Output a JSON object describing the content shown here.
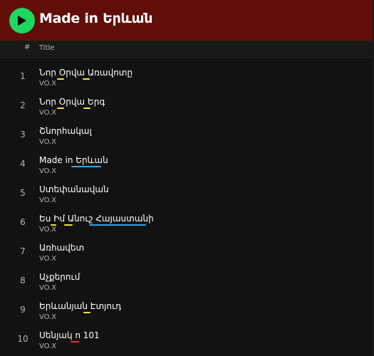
{
  "album": {
    "title": "Made in Երևան"
  },
  "header": {
    "index_label": "#",
    "title_label": "Title"
  },
  "tracks": [
    {
      "number": "1",
      "title": "Նոր Օրվա Առավոտը",
      "artist": "VO.X"
    },
    {
      "number": "2",
      "title": "Նոր Օրվա Երգ",
      "artist": "VO.X"
    },
    {
      "number": "3",
      "title": "Շնորհակալ",
      "artist": "VO.X"
    },
    {
      "number": "4",
      "title": "Made in Երևան",
      "artist": "VO.X"
    },
    {
      "number": "5",
      "title": "Ստեփանավան",
      "artist": "VO.X"
    },
    {
      "number": "6",
      "title": "Ես Իմ Անուշ Հայաստանի",
      "artist": "VO.X"
    },
    {
      "number": "7",
      "title": "Առհավետ",
      "artist": "VO.X"
    },
    {
      "number": "8",
      "title": "Աչքերում",
      "artist": "VO.X"
    },
    {
      "number": "9",
      "title": "Երևանյան Էտյուդ",
      "artist": "VO.X"
    },
    {
      "number": "10",
      "title": "Սենյակ n 101",
      "artist": "VO.X"
    }
  ],
  "colors": {
    "topbar": "#610e08",
    "play": "#1ed760",
    "spell_yellow": "#f2e442",
    "spell_blue": "#3ba3e8",
    "spell_red": "#e0382b"
  },
  "icons": {
    "play": "play-icon"
  }
}
